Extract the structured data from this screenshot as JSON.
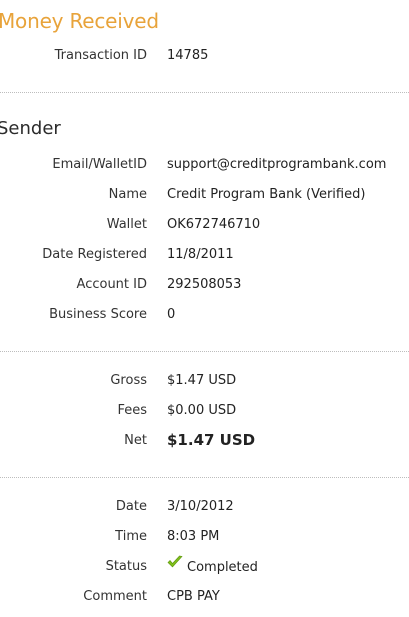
{
  "header": {
    "title": "Money Received"
  },
  "transaction": {
    "id_label": "Transaction ID",
    "id_value": "14785"
  },
  "sender": {
    "section_title": "Sender",
    "email_label": "Email/WalletID",
    "email_value": "support@creditprogrambank.com",
    "name_label": "Name",
    "name_value": "Credit Program Bank (Verified)",
    "wallet_label": "Wallet",
    "wallet_value": "OK672746710",
    "date_registered_label": "Date Registered",
    "date_registered_value": "11/8/2011",
    "account_id_label": "Account ID",
    "account_id_value": "292508053",
    "business_score_label": "Business Score",
    "business_score_value": "0"
  },
  "amounts": {
    "gross_label": "Gross",
    "gross_value": "$1.47 USD",
    "fees_label": "Fees",
    "fees_value": "$0.00 USD",
    "net_label": "Net",
    "net_value": "$1.47 USD"
  },
  "details": {
    "date_label": "Date",
    "date_value": "3/10/2012",
    "time_label": "Time",
    "time_value": "8:03 PM",
    "status_label": "Status",
    "status_icon": "checkmark-icon",
    "status_value": "Completed",
    "comment_label": "Comment",
    "comment_value": "CPB PAY"
  },
  "colors": {
    "title": "#e8a33a",
    "check": "#7fbf1a"
  }
}
